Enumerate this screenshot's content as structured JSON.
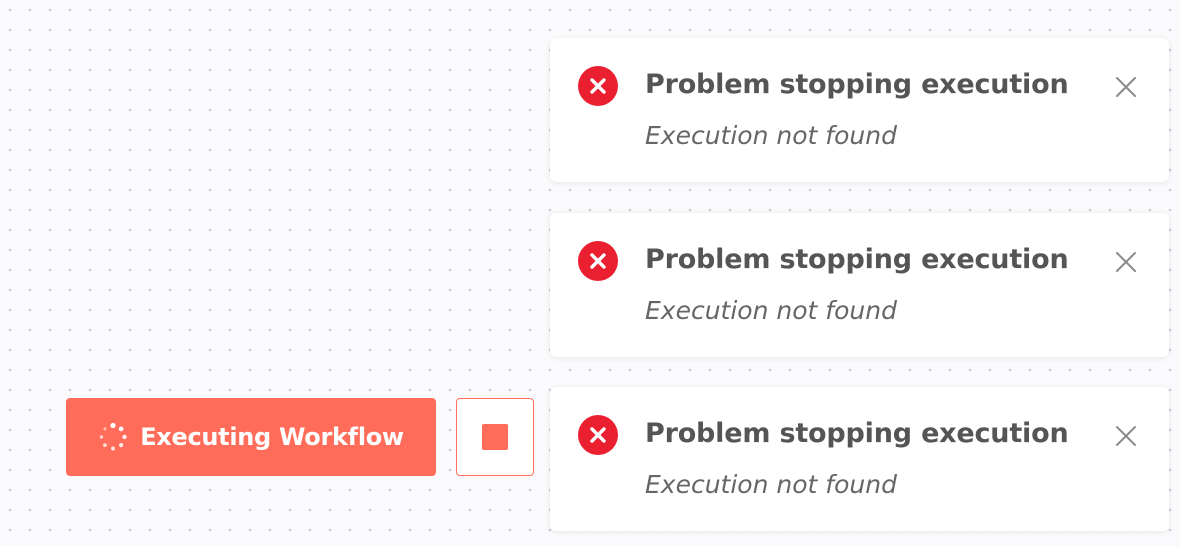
{
  "execute_button": {
    "label": "Executing Workflow",
    "icon": "spinner-icon",
    "state": "executing"
  },
  "stop_button": {
    "icon": "stop-icon"
  },
  "notifications": [
    {
      "type": "error",
      "icon": "error-circle-icon",
      "title": "Problem stopping execution",
      "message": "Execution not found",
      "close_icon": "close-icon"
    },
    {
      "type": "error",
      "icon": "error-circle-icon",
      "title": "Problem stopping execution",
      "message": "Execution not found",
      "close_icon": "close-icon"
    },
    {
      "type": "error",
      "icon": "error-circle-icon",
      "title": "Problem stopping execution",
      "message": "Execution not found",
      "close_icon": "close-icon"
    }
  ],
  "colors": {
    "accent": "#ff6d5a",
    "error": "#ea1f30",
    "canvas_background": "#fafafc",
    "canvas_dots": "#c9c9d2",
    "title_text": "#555555",
    "message_text": "#666666"
  }
}
